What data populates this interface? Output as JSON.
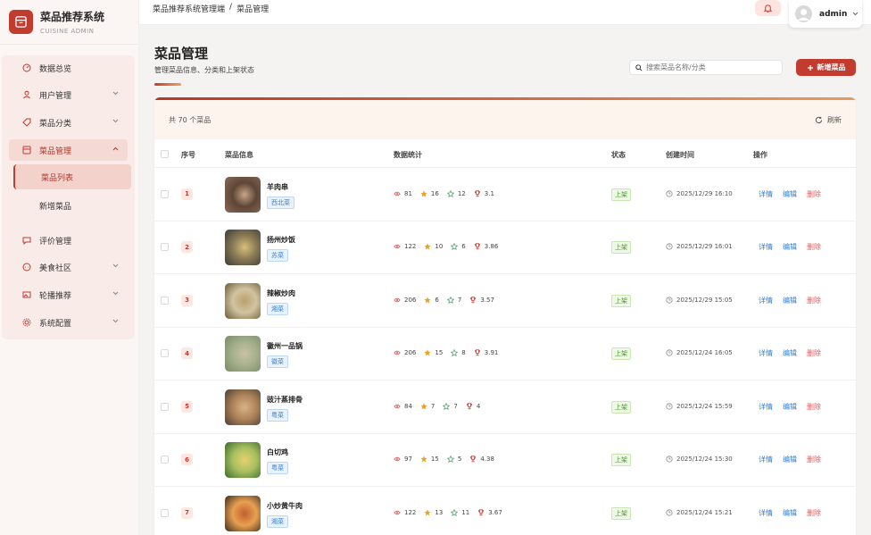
{
  "brand": {
    "title": "菜品推荐系统",
    "subtitle": "CUISINE ADMIN"
  },
  "sidebar": {
    "items": [
      {
        "label": "数据总览"
      },
      {
        "label": "用户管理"
      },
      {
        "label": "菜品分类"
      },
      {
        "label": "菜品管理"
      },
      {
        "label": "评价管理"
      },
      {
        "label": "美食社区"
      },
      {
        "label": "轮播推荐"
      },
      {
        "label": "系统配置"
      }
    ],
    "sub_items": [
      {
        "label": "菜品列表"
      },
      {
        "label": "新增菜品"
      }
    ]
  },
  "breadcrumb": {
    "root": "菜品推荐系统管理端",
    "sep": "/",
    "current": "菜品管理"
  },
  "user": {
    "name": "admin"
  },
  "page": {
    "title": "菜品管理",
    "subtitle": "管理菜品信息、分类和上架状态"
  },
  "search": {
    "placeholder": "搜索菜品名称/分类"
  },
  "add_button": "新增菜品",
  "card": {
    "count_text": "共 70 个菜品",
    "refresh": "刷新"
  },
  "columns": {
    "index": "序号",
    "info": "菜品信息",
    "stats": "数据统计",
    "status": "状态",
    "created": "创建时间",
    "ops": "操作"
  },
  "actions": {
    "detail": "详情",
    "edit": "编辑",
    "delete": "删除"
  },
  "rows": [
    {
      "idx": "1",
      "name": "羊肉串",
      "tag": "西北菜",
      "views": "81",
      "likes": "16",
      "favs": "12",
      "score": "3.1",
      "status": "上架",
      "created": "2025/12/29 16:10"
    },
    {
      "idx": "2",
      "name": "扬州炒饭",
      "tag": "苏菜",
      "views": "122",
      "likes": "10",
      "favs": "6",
      "score": "3.86",
      "status": "上架",
      "created": "2025/12/29 16:01"
    },
    {
      "idx": "3",
      "name": "辣椒炒肉",
      "tag": "湘菜",
      "views": "206",
      "likes": "6",
      "favs": "7",
      "score": "3.57",
      "status": "上架",
      "created": "2025/12/29 15:05"
    },
    {
      "idx": "4",
      "name": "徽州一品锅",
      "tag": "徽菜",
      "views": "206",
      "likes": "15",
      "favs": "8",
      "score": "3.91",
      "status": "上架",
      "created": "2025/12/24 16:05"
    },
    {
      "idx": "5",
      "name": "豉汁蒸排骨",
      "tag": "粤菜",
      "views": "84",
      "likes": "7",
      "favs": "7",
      "score": "4",
      "status": "上架",
      "created": "2025/12/24 15:59"
    },
    {
      "idx": "6",
      "name": "白切鸡",
      "tag": "粤菜",
      "views": "97",
      "likes": "15",
      "favs": "5",
      "score": "4.38",
      "status": "上架",
      "created": "2025/12/24 15:30"
    },
    {
      "idx": "7",
      "name": "小炒黄牛肉",
      "tag": "湘菜",
      "views": "122",
      "likes": "13",
      "favs": "11",
      "score": "3.67",
      "status": "上架",
      "created": "2025/12/24 15:21"
    }
  ],
  "colors": {
    "accent": "#c23b2f",
    "link": "#2f7fd3",
    "danger": "#e05a5a",
    "success": "#4c9a2a"
  }
}
